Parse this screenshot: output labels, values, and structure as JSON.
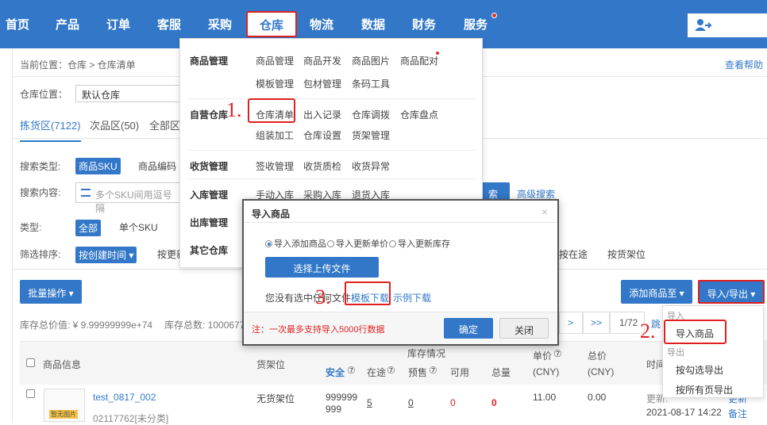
{
  "nav": {
    "items": [
      "首页",
      "产品",
      "订单",
      "客服",
      "采购",
      "仓库",
      "物流",
      "数据",
      "财务",
      "服务"
    ],
    "active": "仓库"
  },
  "breadcrumb": "当前位置：仓库 > 仓库清单",
  "help": "查看帮助",
  "warehouse": {
    "label": "仓库位置：",
    "value": "默认仓库"
  },
  "tabs": [
    "拣货区(7122)",
    "次品区(50)",
    "全部区("
  ],
  "search": {
    "type_label": "搜索类型:",
    "type_active": "商品SKU",
    "type_other": "商品编码",
    "content_label": "搜索内容:",
    "placeholder": "多个SKU间用逗号隔",
    "search_btn": "索",
    "advanced": "高级搜索"
  },
  "filter": {
    "type_label": "类型:",
    "all": "全部",
    "single": "单个SKU",
    "sort_label": "筛选排序:",
    "sort_value": "按创建时间 ▾",
    "sort_next": "按更新",
    "in_transit": "按在途",
    "shelf": "按货架位"
  },
  "toolbar": {
    "batch": "批量操作 ▾",
    "add_to": "添加商品至 ▾",
    "import_export": "导入/导出 ▾"
  },
  "stats": {
    "total_value": "库存总价值: ¥ 9.99999999e+74",
    "total_qty": "库存总数: 10006776"
  },
  "pagination": {
    "next": ">",
    "last": ">>",
    "page": "1/72",
    "jump": "跳"
  },
  "table": {
    "headers": {
      "info": "商品信息",
      "shelf": "货架位",
      "stock": "库存情况",
      "safe": "安全",
      "transit": "在途",
      "reserve": "预售",
      "available": "可用",
      "total": "总量",
      "price": "单价",
      "price_unit": "(CNY)",
      "total_price": "总价",
      "total_unit": "(CNY)",
      "time": "时间"
    },
    "row": {
      "name": "test_0817_002",
      "code": "02117762[未分类]",
      "image_badge": "暂无图片",
      "shelf": "无货架位",
      "safe": "999999 999",
      "transit": "5",
      "reserve": "0",
      "available": "0",
      "total": "0",
      "price": "11.00",
      "total_price": "0.00",
      "time_label": "更新:",
      "time": "2021-08-17 14:22",
      "action_update": "更新",
      "action_note": "备注"
    }
  },
  "menu": {
    "cat_product": "商品管理",
    "product": [
      "商品管理",
      "商品开发",
      "商品图片",
      "商品配对",
      "模板管理",
      "包材管理",
      "条码工具"
    ],
    "cat_self": "自营仓库",
    "self": [
      "仓库清单",
      "出入记录",
      "仓库调拨",
      "仓库盘点",
      "组装加工",
      "仓库设置",
      "货架管理"
    ],
    "cat_receive": "收货管理",
    "receive": [
      "签收管理",
      "收货质检",
      "收货异常"
    ],
    "cat_inbound": "入库管理",
    "inbound": [
      "手动入库",
      "采购入库",
      "退货入库"
    ],
    "cat_outbound": "出库管理",
    "cat_other": "其它仓库"
  },
  "modal": {
    "title": "导入商品",
    "close": "×",
    "options": [
      "导入添加商品",
      "导入更新单价",
      "导入更新库存"
    ],
    "upload": "选择上传文件",
    "note": "您没有选中任何文件",
    "template": "模板下载",
    "sample": "示例下载",
    "limit": "注：一次最多支持导入5000行数据",
    "confirm": "确定",
    "cancel": "关闭"
  },
  "dropdown": {
    "import_hdr": "导入",
    "import_item": "导入商品",
    "export_hdr": "导出",
    "export_checked": "按勾选导出",
    "export_all": "按所有页导出"
  },
  "steps": [
    "1.",
    "2.",
    "3."
  ],
  "colors": {
    "primary": "#3378c8",
    "highlight": "#e02020"
  }
}
